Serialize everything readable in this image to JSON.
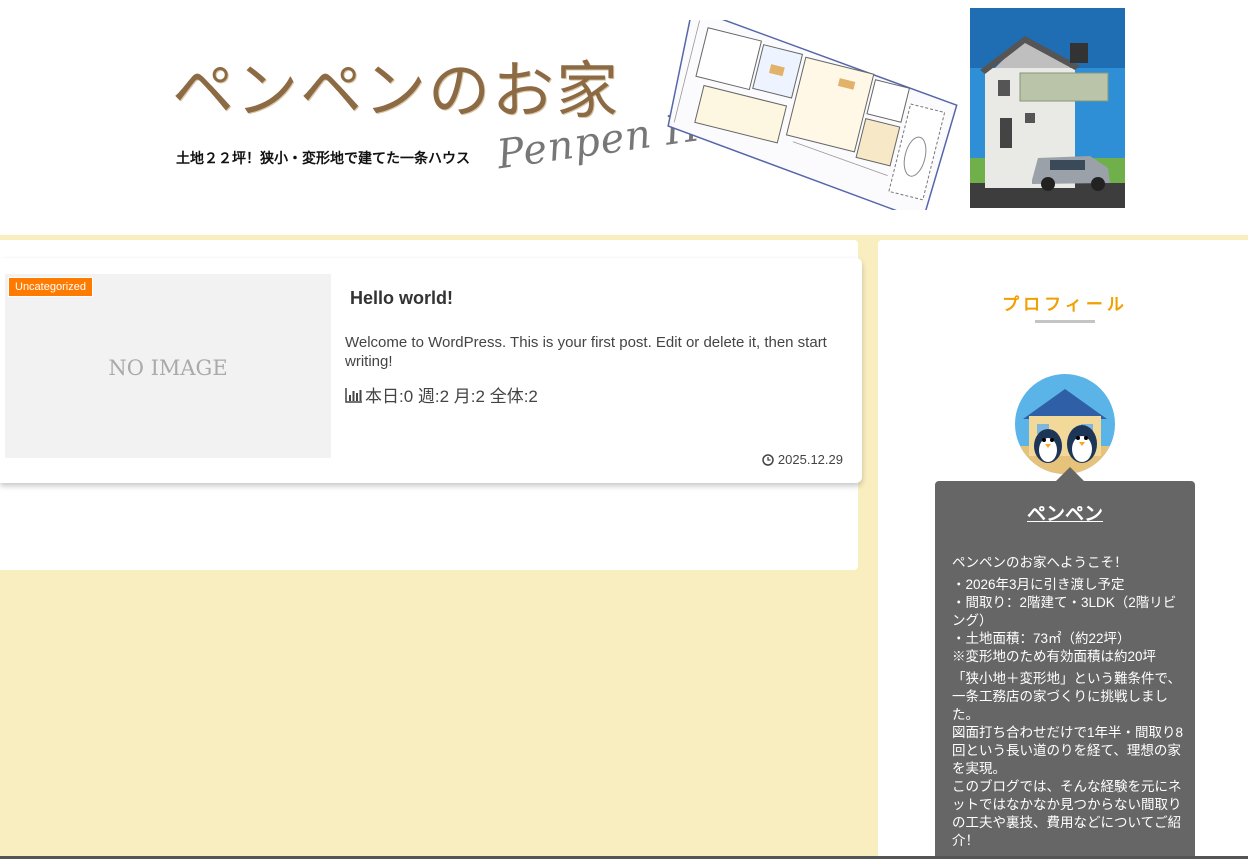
{
  "header": {
    "logo_text": "ペンペンのお家",
    "tagline": "土地２２坪！狭小・変形地で建てた一条ハウス",
    "script_title": "Penpen Home"
  },
  "post": {
    "category": "Uncategorized",
    "no_image": "NO IMAGE",
    "title": "Hello world!",
    "excerpt": "Welcome to WordPress. This is your first post. Edit or delete it, then start writing!",
    "stats": "本日:0 週:2 月:2 全体:2",
    "date": "2025.12.29"
  },
  "sidebar": {
    "widget_title": "プロフィール",
    "profile": {
      "name": "ペンペン",
      "greeting": "ペンペンのお家へようこそ！",
      "facts": "・2026年3月に引き渡し予定\n・間取り：2階建て・3LDK（2階リビング）\n・土地面積：73㎡（約22坪）\n※変形地のため有効面積は約20坪",
      "story": "「狭小地＋変形地」という難条件で、一条工務店の家づくりに挑戦しました。\n図面打ち合わせだけで1年半・間取り8回という長い道のりを経て、理想の家を実現。\nこのブログでは、そんな経験を元にネットではなかなか見つからない間取りの工夫や裏技、費用などについてご紹介！"
    }
  },
  "colors": {
    "page_bg": "#f9eec0",
    "accent_orange": "#ff7b00",
    "widget_title": "#f0a000",
    "profile_box": "#666666",
    "logo_brown": "#8b6a44"
  },
  "icons": {
    "stats": "bar-chart-icon",
    "date": "clock-icon"
  }
}
